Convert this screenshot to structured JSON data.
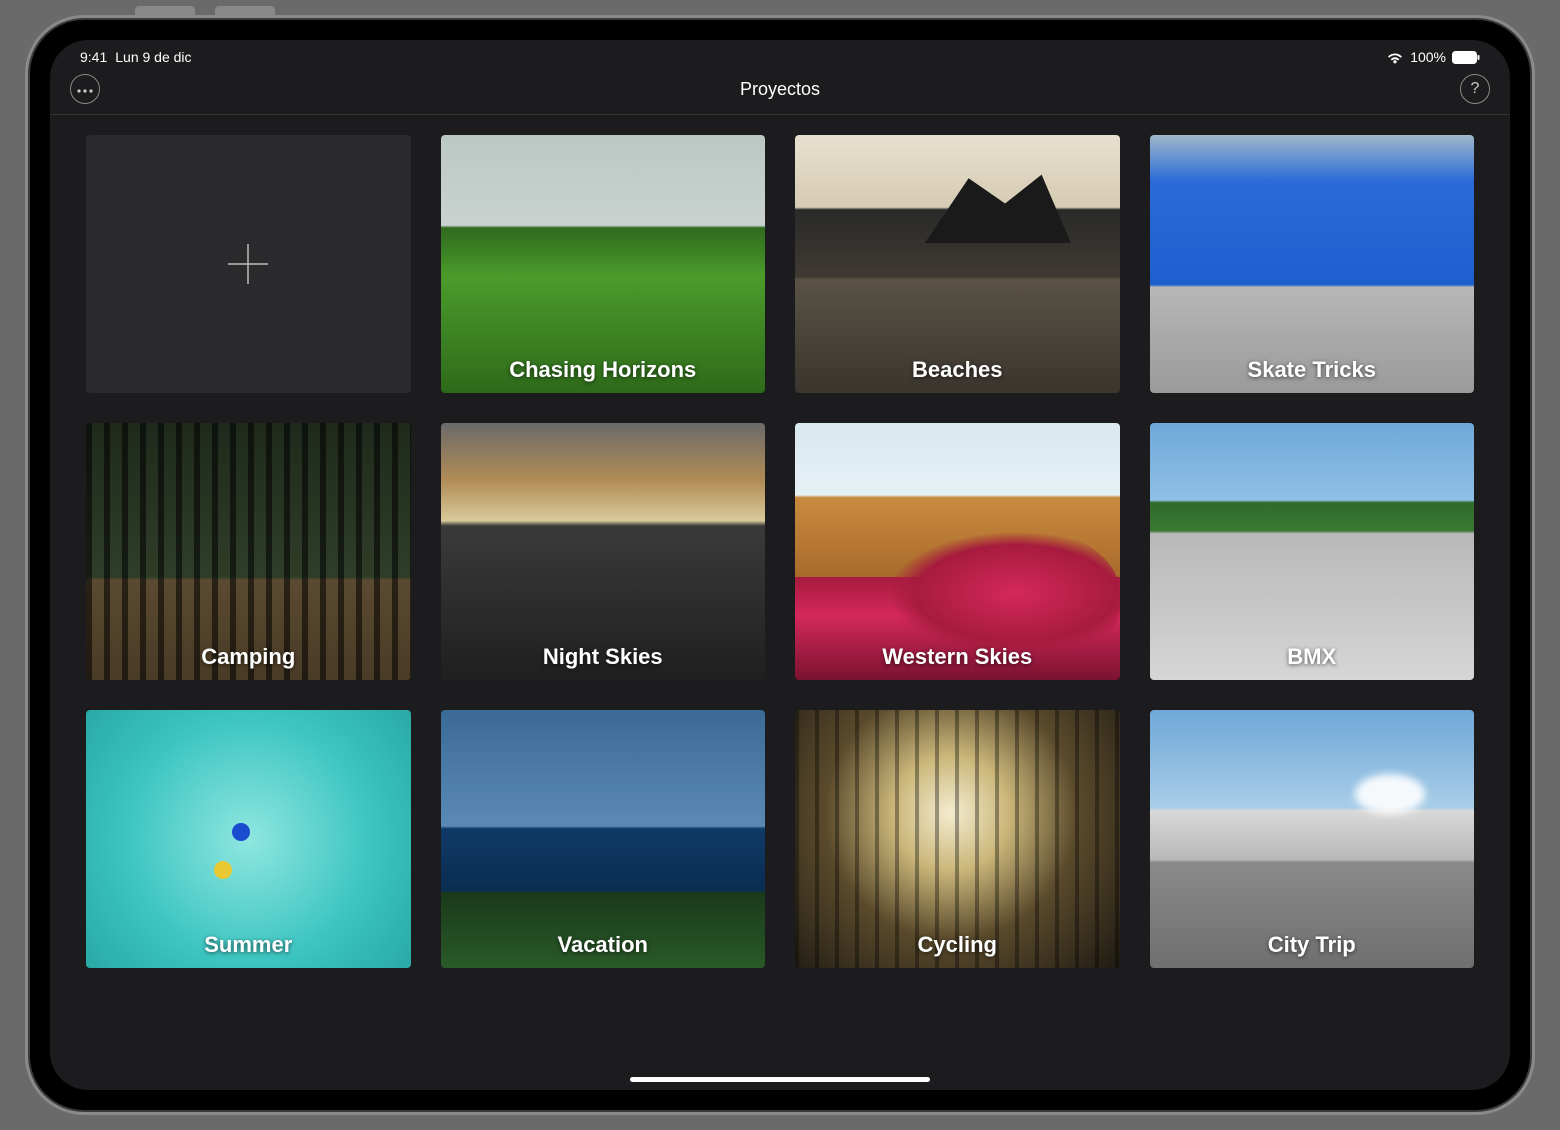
{
  "status": {
    "time": "9:41",
    "date": "Lun 9 de dic",
    "battery_pct": "100%"
  },
  "nav": {
    "title": "Proyectos"
  },
  "projects": [
    {
      "title": "Chasing Horizons",
      "thumb": "th-chasing"
    },
    {
      "title": "Beaches",
      "thumb": "th-beaches"
    },
    {
      "title": "Skate Tricks",
      "thumb": "th-skate"
    },
    {
      "title": "Camping",
      "thumb": "th-camping"
    },
    {
      "title": "Night Skies",
      "thumb": "th-night"
    },
    {
      "title": "Western Skies",
      "thumb": "th-western"
    },
    {
      "title": "BMX",
      "thumb": "th-bmx"
    },
    {
      "title": "Summer",
      "thumb": "th-summer"
    },
    {
      "title": "Vacation",
      "thumb": "th-vacation"
    },
    {
      "title": "Cycling",
      "thumb": "th-cycling"
    },
    {
      "title": "City Trip",
      "thumb": "th-city"
    }
  ]
}
